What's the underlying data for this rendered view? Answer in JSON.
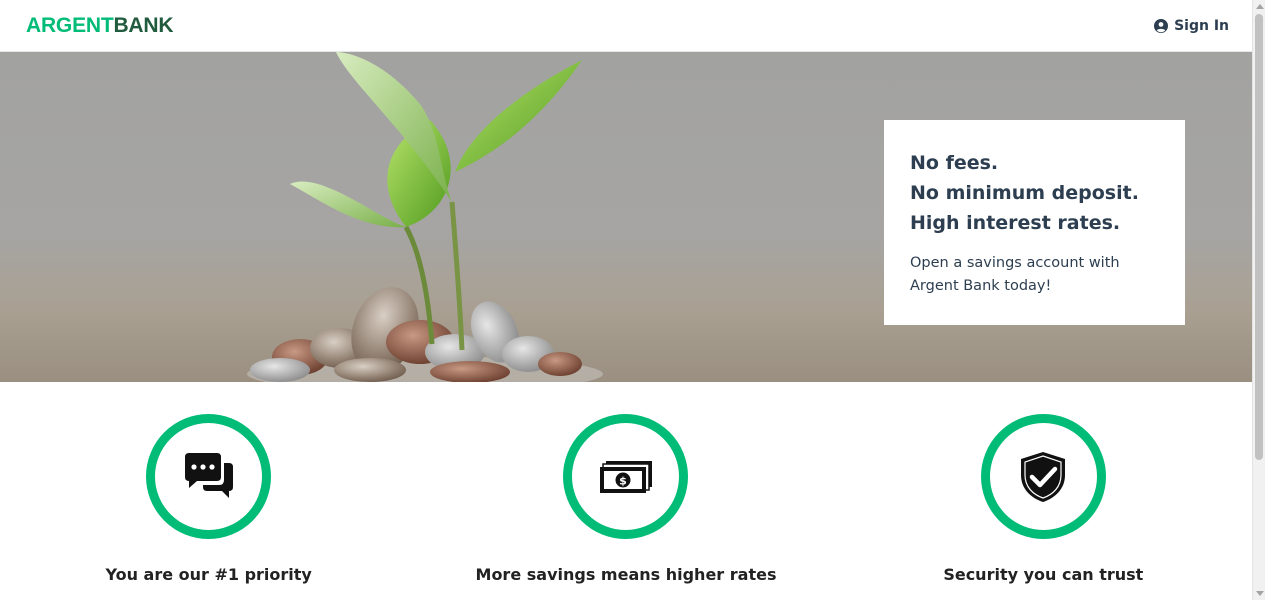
{
  "header": {
    "logo_part1": "ARGENT",
    "logo_part2": "BANK",
    "signin_label": "Sign In",
    "signin_icon": "user-circle-icon"
  },
  "hero": {
    "subtitles": [
      "No fees.",
      "No minimum deposit.",
      "High interest rates."
    ],
    "text": "Open a savings account with Argent Bank today!"
  },
  "features": [
    {
      "icon": "chat-icon",
      "title": "You are our #1 priority"
    },
    {
      "icon": "money-icon",
      "title": "More savings means higher rates"
    },
    {
      "icon": "shield-check-icon",
      "title": "Security you can trust"
    }
  ],
  "colors": {
    "brand_green": "#00bc77",
    "brand_dark_green": "#1f5b3c",
    "text_dark": "#2c3e50"
  }
}
